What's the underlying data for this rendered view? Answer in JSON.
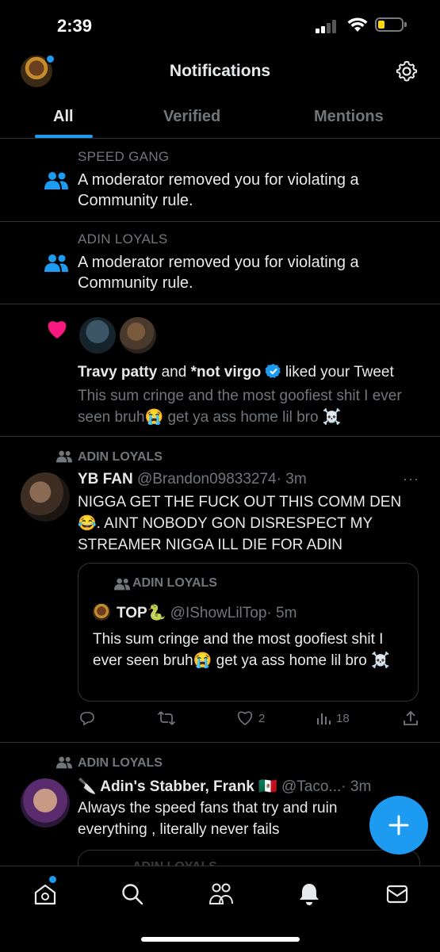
{
  "status_bar": {
    "time": "2:39"
  },
  "header": {
    "title": "Notifications"
  },
  "tabs": [
    {
      "label": "All",
      "active": true
    },
    {
      "label": "Verified",
      "active": false
    },
    {
      "label": "Mentions",
      "active": false
    }
  ],
  "notifications": [
    {
      "type": "community_removal",
      "community": "SPEED GANG",
      "text": "A moderator removed you for violating a Community rule."
    },
    {
      "type": "community_removal",
      "community": "ADIN LOYALS",
      "text": "A moderator removed you for violating a Community rule."
    },
    {
      "type": "like",
      "user1": "Travy patty",
      "joiner": " and ",
      "user2": "*not virgo",
      "action": " liked your Tweet",
      "tweet_text": "This sum cringe and the most goofiest shit I ever seen bruh😭 get ya ass home lil bro ☠️"
    }
  ],
  "post1": {
    "community": "ADIN LOYALS",
    "name": "YB FAN",
    "handle": "@Brandon09833274",
    "time": "· 3m",
    "text": "NIGGA GET THE FUCK OUT THIS COMM DEN 😂. AINT NOBODY GON DISRESPECT MY STREAMER NIGGA ILL DIE FOR ADIN",
    "quote": {
      "community": "ADIN LOYALS",
      "name": "TOP🐍",
      "handle": "@IShowLilTop",
      "time": "· 5m",
      "text": "This sum cringe and the most goofiest shit I ever seen bruh😭 get ya ass home lil bro ☠️"
    },
    "actions": {
      "replies": "",
      "retweets": "",
      "likes": "2",
      "views": "18"
    }
  },
  "post2": {
    "community": "ADIN LOYALS",
    "name": "🔪 Adin's Stabber, Frank 🇲🇽",
    "handle": "@Taco...",
    "time": "· 3m",
    "text": "Always the speed fans that try and ruin everything , literally never fails",
    "quote_community_peek": "ADIN LOYALS"
  },
  "colors": {
    "accent": "#1d9bf0",
    "like": "#f91880",
    "muted": "#71767b",
    "background": "#000000"
  },
  "icons": [
    "settings-gear-icon",
    "people-icon",
    "heart-icon",
    "verified-badge-icon",
    "reply-icon",
    "retweet-icon",
    "like-icon",
    "views-icon",
    "share-icon",
    "more-icon",
    "compose-plus-icon",
    "home-icon",
    "search-icon",
    "communities-icon",
    "notifications-bell-icon",
    "messages-icon"
  ]
}
